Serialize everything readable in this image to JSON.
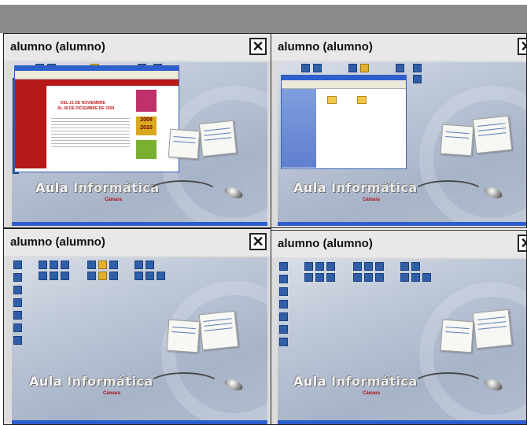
{
  "panels": [
    {
      "title": "alumno (alumno)",
      "close_label": "✕"
    },
    {
      "title": "alumno (alumno)",
      "close_label": "✕"
    },
    {
      "title": "alumno (alumno)",
      "close_label": "✕"
    },
    {
      "title": "alumno (alumno)",
      "close_label": "✕"
    }
  ],
  "desktop": {
    "brand_word1": "Aula",
    "brand_word2": "Informática",
    "camara_logo_text": "Cámara"
  },
  "browser_window": {
    "headline_line1": "DEL 21 DE NOVIEMBRE",
    "headline_line2": "AL 06 DE DICIEMBRE DE 2009",
    "year_badge": "2009 2010"
  },
  "colors": {
    "topbar": "#8b8b8b",
    "taskbar": "#2b5ecb",
    "accent_red": "#b71818"
  }
}
